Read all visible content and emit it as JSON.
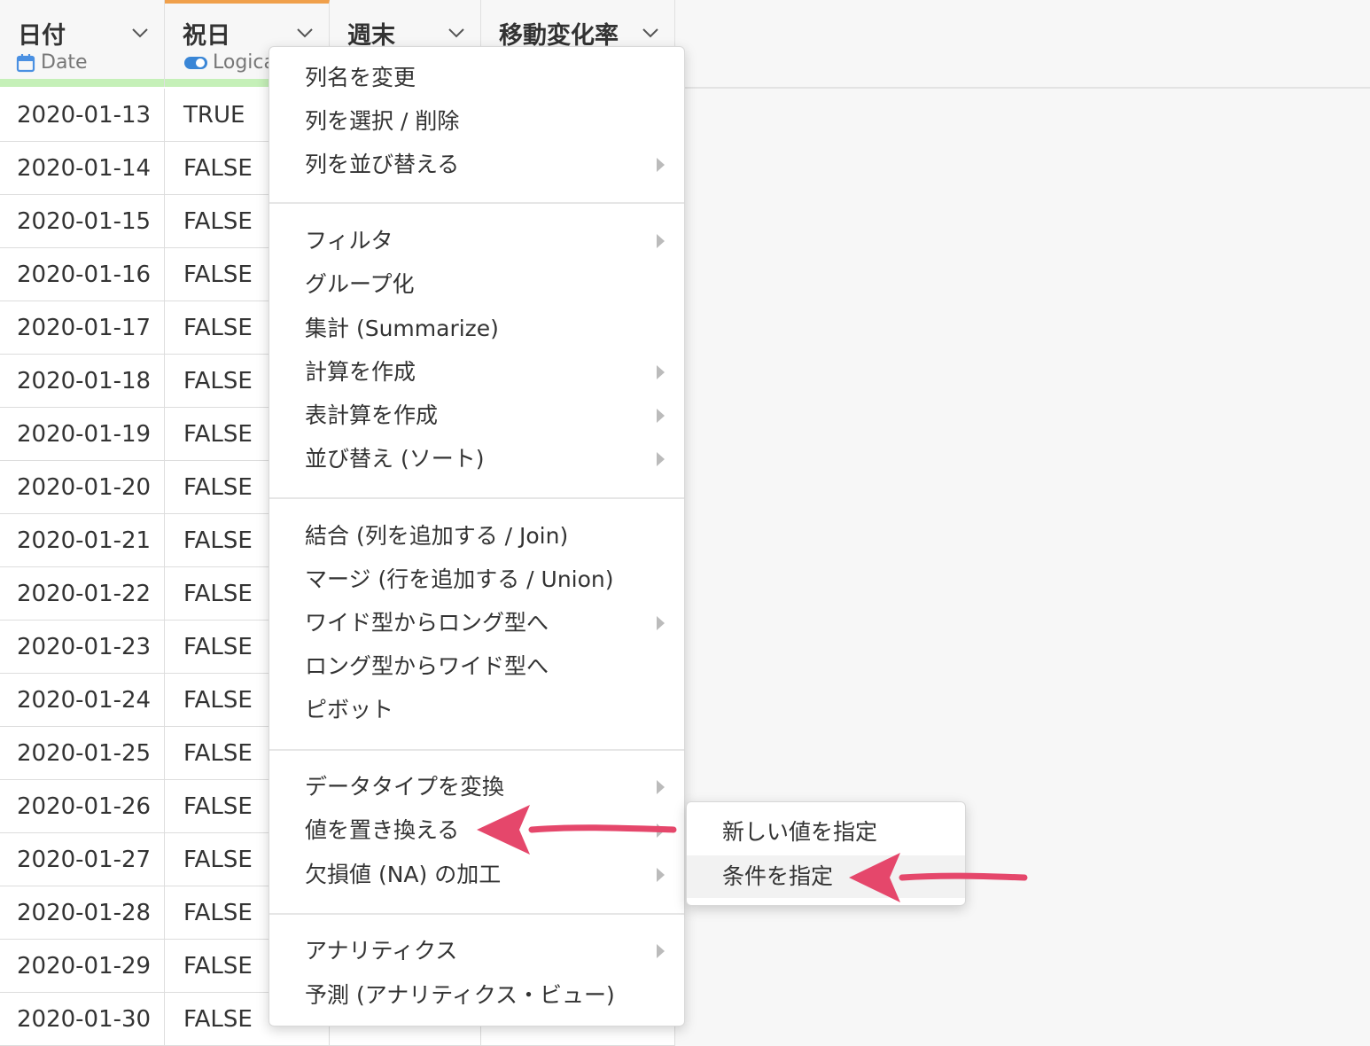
{
  "columns": [
    {
      "name": "日付",
      "type": "Date",
      "type_icon": "calendar-icon"
    },
    {
      "name": "祝日",
      "type": "Logica",
      "type_icon": "toggle-icon"
    },
    {
      "name": "週末",
      "type": "",
      "type_icon": ""
    },
    {
      "name": "移動変化率",
      "type": "",
      "type_icon": ""
    }
  ],
  "rows": [
    {
      "date": "2020-01-13",
      "holiday": "TRUE"
    },
    {
      "date": "2020-01-14",
      "holiday": "FALSE"
    },
    {
      "date": "2020-01-15",
      "holiday": "FALSE"
    },
    {
      "date": "2020-01-16",
      "holiday": "FALSE"
    },
    {
      "date": "2020-01-17",
      "holiday": "FALSE"
    },
    {
      "date": "2020-01-18",
      "holiday": "FALSE"
    },
    {
      "date": "2020-01-19",
      "holiday": "FALSE"
    },
    {
      "date": "2020-01-20",
      "holiday": "FALSE"
    },
    {
      "date": "2020-01-21",
      "holiday": "FALSE"
    },
    {
      "date": "2020-01-22",
      "holiday": "FALSE"
    },
    {
      "date": "2020-01-23",
      "holiday": "FALSE"
    },
    {
      "date": "2020-01-24",
      "holiday": "FALSE"
    },
    {
      "date": "2020-01-25",
      "holiday": "FALSE"
    },
    {
      "date": "2020-01-26",
      "holiday": "FALSE"
    },
    {
      "date": "2020-01-27",
      "holiday": "FALSE"
    },
    {
      "date": "2020-01-28",
      "holiday": "FALSE"
    },
    {
      "date": "2020-01-29",
      "holiday": "FALSE"
    },
    {
      "date": "2020-01-30",
      "holiday": "FALSE"
    }
  ],
  "menu": {
    "items": [
      {
        "label": "列名を変更",
        "submenu": false
      },
      {
        "label": "列を選択 / 削除",
        "submenu": false
      },
      {
        "label": "列を並び替える",
        "submenu": true
      },
      {
        "label": "フィルタ",
        "submenu": true
      },
      {
        "label": "グループ化",
        "submenu": false
      },
      {
        "label": "集計 (Summarize)",
        "submenu": false
      },
      {
        "label": "計算を作成",
        "submenu": true
      },
      {
        "label": "表計算を作成",
        "submenu": true
      },
      {
        "label": "並び替え (ソート)",
        "submenu": true
      },
      {
        "label": "結合 (列を追加する / Join)",
        "submenu": false
      },
      {
        "label": "マージ (行を追加する / Union)",
        "submenu": false
      },
      {
        "label": "ワイド型からロング型へ",
        "submenu": true
      },
      {
        "label": "ロング型からワイド型へ",
        "submenu": false
      },
      {
        "label": "ピボット",
        "submenu": false
      },
      {
        "label": "データタイプを変換",
        "submenu": true
      },
      {
        "label": "値を置き換える",
        "submenu": true
      },
      {
        "label": "欠損値 (NA) の加工",
        "submenu": true
      },
      {
        "label": "アナリティクス",
        "submenu": true
      },
      {
        "label": "予測 (アナリティクス・ビュー)",
        "submenu": false
      }
    ]
  },
  "submenu": {
    "items": [
      {
        "label": "新しい値を指定"
      },
      {
        "label": "条件を指定"
      }
    ]
  },
  "colors": {
    "accent_orange": "#f0a04b",
    "quality_bar": "#c5f0b8",
    "date_icon": "#4a90e2",
    "annotation_arrow": "#e5476b"
  }
}
